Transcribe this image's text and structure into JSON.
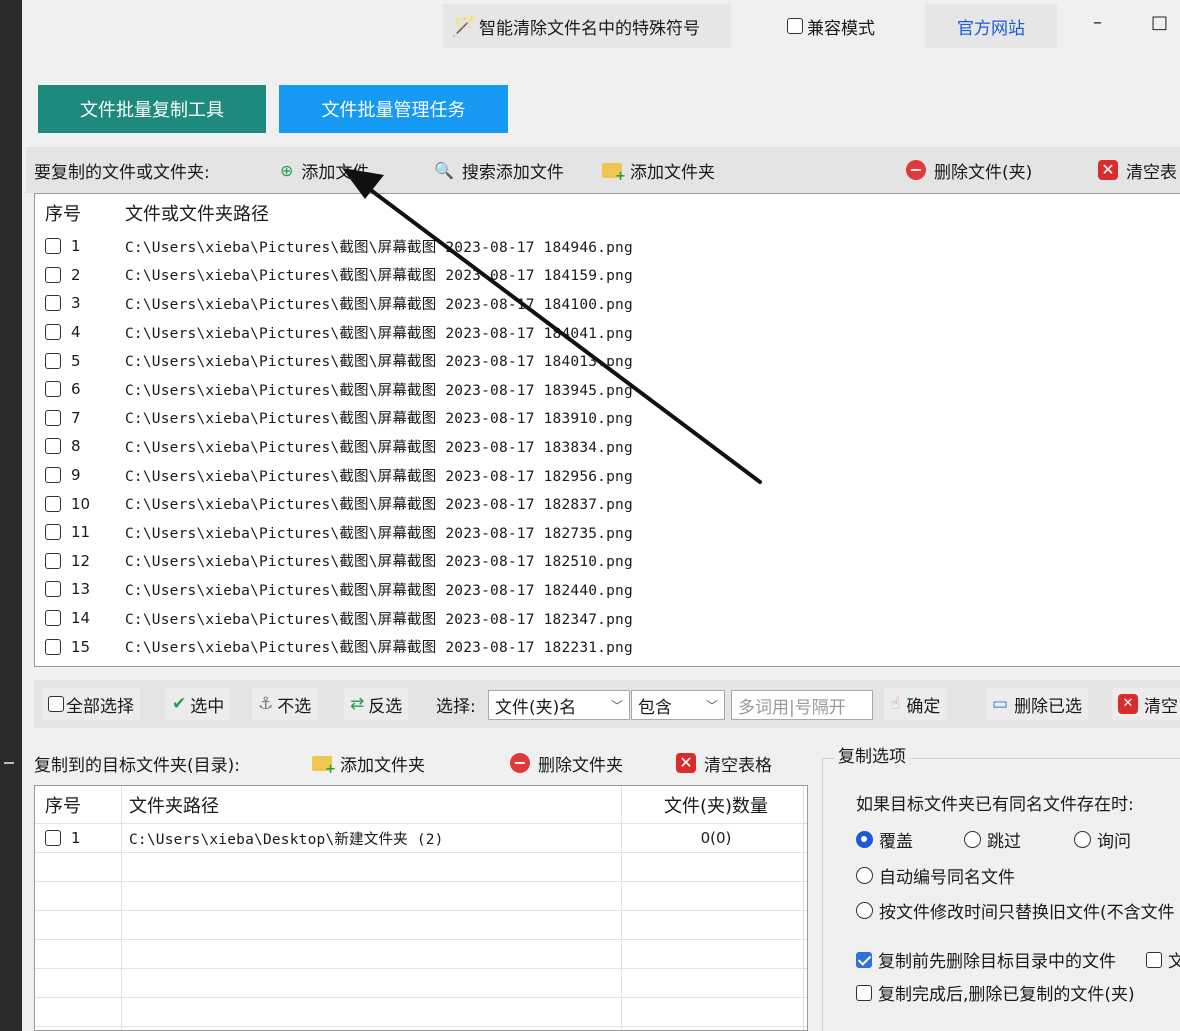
{
  "titlebar": {
    "magic_icon": "magic-wand-icon",
    "magic_label": "智能清除文件名中的特殊符号",
    "compat_label": "兼容模式",
    "site_label": "官方网站",
    "minimize": "–",
    "maximize": "□"
  },
  "tabs": [
    {
      "label": "文件批量复制工具"
    },
    {
      "label": "文件批量管理任务"
    }
  ],
  "source_toolbar": {
    "label": "要复制的文件或文件夹:",
    "add_file": "添加文件",
    "search_add": "搜索添加文件",
    "add_folder": "添加文件夹",
    "delete": "删除文件(夹)",
    "clear": "清空表"
  },
  "file_list": {
    "col_index": "序号",
    "col_path": "文件或文件夹路径",
    "rows": [
      {
        "idx": "1",
        "path": "C:\\Users\\xieba\\Pictures\\截图\\屏幕截图 2023-08-17 184946.png"
      },
      {
        "idx": "2",
        "path": "C:\\Users\\xieba\\Pictures\\截图\\屏幕截图 2023-08-17 184159.png"
      },
      {
        "idx": "3",
        "path": "C:\\Users\\xieba\\Pictures\\截图\\屏幕截图 2023-08-17 184100.png"
      },
      {
        "idx": "4",
        "path": "C:\\Users\\xieba\\Pictures\\截图\\屏幕截图 2023-08-17 184041.png"
      },
      {
        "idx": "5",
        "path": "C:\\Users\\xieba\\Pictures\\截图\\屏幕截图 2023-08-17 184013.png"
      },
      {
        "idx": "6",
        "path": "C:\\Users\\xieba\\Pictures\\截图\\屏幕截图 2023-08-17 183945.png"
      },
      {
        "idx": "7",
        "path": "C:\\Users\\xieba\\Pictures\\截图\\屏幕截图 2023-08-17 183910.png"
      },
      {
        "idx": "8",
        "path": "C:\\Users\\xieba\\Pictures\\截图\\屏幕截图 2023-08-17 183834.png"
      },
      {
        "idx": "9",
        "path": "C:\\Users\\xieba\\Pictures\\截图\\屏幕截图 2023-08-17 182956.png"
      },
      {
        "idx": "10",
        "path": "C:\\Users\\xieba\\Pictures\\截图\\屏幕截图 2023-08-17 182837.png"
      },
      {
        "idx": "11",
        "path": "C:\\Users\\xieba\\Pictures\\截图\\屏幕截图 2023-08-17 182735.png"
      },
      {
        "idx": "12",
        "path": "C:\\Users\\xieba\\Pictures\\截图\\屏幕截图 2023-08-17 182510.png"
      },
      {
        "idx": "13",
        "path": "C:\\Users\\xieba\\Pictures\\截图\\屏幕截图 2023-08-17 182440.png"
      },
      {
        "idx": "14",
        "path": "C:\\Users\\xieba\\Pictures\\截图\\屏幕截图 2023-08-17 182347.png"
      },
      {
        "idx": "15",
        "path": "C:\\Users\\xieba\\Pictures\\截图\\屏幕截图 2023-08-17 182231.png"
      }
    ]
  },
  "select_bar": {
    "select_all": "全部选择",
    "select": "选中",
    "deselect": "不选",
    "invert": "反选",
    "choose_label": "选择:",
    "field_value": "文件(夹)名",
    "match_value": "包含",
    "keyword_placeholder": "多词用|号隔开",
    "confirm": "确定",
    "delete_selected": "删除已选",
    "clear": "清空"
  },
  "target_toolbar": {
    "label": "复制到的目标文件夹(目录):",
    "add_folder": "添加文件夹",
    "delete_folder": "删除文件夹",
    "clear": "清空表格"
  },
  "target_list": {
    "col_index": "序号",
    "col_path": "文件夹路径",
    "col_count": "文件(夹)数量",
    "rows": [
      {
        "idx": "1",
        "path": "C:\\Users\\xieba\\Desktop\\新建文件夹 (2)",
        "count": "0(0)"
      }
    ]
  },
  "copy_options": {
    "title": "复制选项",
    "conflict_label": "如果目标文件夹已有同名文件存在时:",
    "overwrite": "覆盖",
    "skip": "跳过",
    "ask": "询问",
    "auto_number": "自动编号同名文件",
    "replace_by_time": "按文件修改时间只替换旧文件(不含文件",
    "delete_target_before": "复制前先删除目标目录中的文件",
    "extra": "文",
    "delete_after_copy": "复制完成后,删除已复制的文件(夹)",
    "selected_conflict": "覆盖",
    "delete_target_before_checked": true,
    "accent_color": "#1a5bd8"
  }
}
